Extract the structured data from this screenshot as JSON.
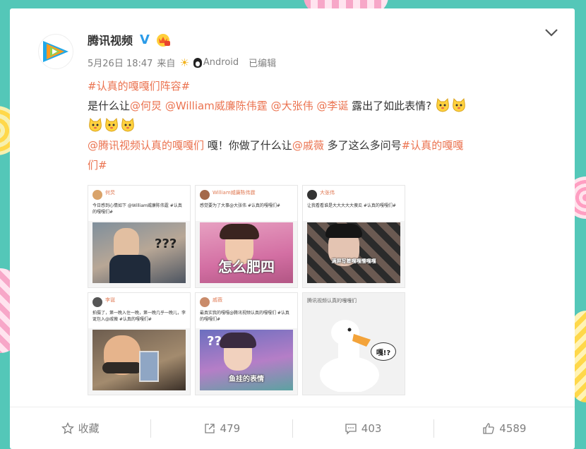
{
  "post": {
    "author": "腾讯视频",
    "date": "5月26日 18:47",
    "source_prefix": "来自",
    "source_device": "Android",
    "edited": "已编辑",
    "text": {
      "hashtag1": "#认真的嘎嘎们阵容#",
      "line2_prefix": "是什么让",
      "mention1": "@何炅",
      "mention2": "@William威廉陈伟霆",
      "mention3": "@大张伟",
      "mention4": "@李诞",
      "line2_suffix": "露出了如此表情?",
      "mention5": "@腾讯视频认真的嘎嘎们",
      "line4_mid": "嘎！你做了什么让",
      "mention6": "@戚薇",
      "line4_suffix": "多了这么多问号",
      "hashtag2a": "#认真的嘎嘎",
      "hashtag2b": "们#"
    },
    "images": [
      {
        "name": "何炅",
        "text": "今日感到心情如下 @William威廉陈伟霆 #认真的嘎嘎们#",
        "caption": ""
      },
      {
        "name": "William威廉陈伟霆",
        "text": "感觉要为了大事@大张伟 #认真的嘎嘎们#",
        "caption": "怎么肥四"
      },
      {
        "name": "大张伟",
        "text": "让我看看谁是大大大大大傻瓜 #认真的嘎嘎们#",
        "caption": "满屏写着嘎嘎懵嘎嘎"
      },
      {
        "name": "李诞",
        "text": "拍摄了，第一晚入住一晚，第一晚几乎一晚儿，李诞包入@戚薇 #认真的嘎嘎们#",
        "caption": ""
      },
      {
        "name": "戚薇",
        "text": "最真实我的嘎嘎@腾讯视频认真的嘎嘎们 #认真的嘎嘎们#",
        "caption": "鱼挂的表情"
      },
      {
        "name": "腾讯视频认真的嘎嘎们",
        "text": "",
        "caption": "嘎!?"
      }
    ]
  },
  "actions": {
    "favorite": "收藏",
    "repost_count": "479",
    "comment_count": "403",
    "like_count": "4589"
  },
  "icons": {
    "avatar": "tencent-video-logo",
    "verified": "verified-v-icon",
    "crown": "vip-crown-icon",
    "more": "chevron-down-icon",
    "favorite": "star-icon",
    "repost": "share-icon",
    "comment": "comment-icon",
    "like": "thumb-up-icon"
  },
  "colors": {
    "link": "#eb7350",
    "background": "#54c7b8",
    "text": "#333333",
    "meta": "#808080"
  }
}
